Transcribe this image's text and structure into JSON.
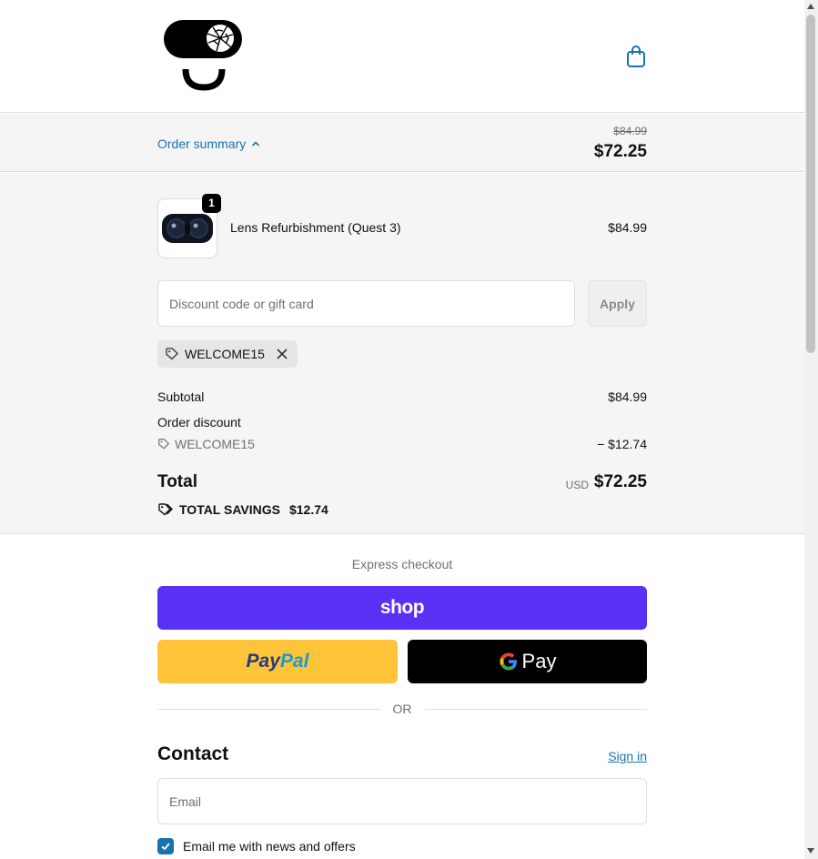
{
  "header": {
    "logo_icon": "broken-lens-face-logo",
    "cart_icon": "shopping-bag-icon"
  },
  "summary_toggle": {
    "label": "Order summary",
    "original_price": "$84.99",
    "price": "$72.25"
  },
  "product": {
    "quantity": "1",
    "name": "Lens Refurbishment (Quest 3)",
    "price": "$84.99"
  },
  "discount": {
    "placeholder": "Discount code or gift card",
    "apply_label": "Apply",
    "applied_code": "WELCOME15"
  },
  "totals": {
    "subtotal_label": "Subtotal",
    "subtotal_value": "$84.99",
    "order_discount_label": "Order discount",
    "discount_code": "WELCOME15",
    "discount_value": "− $12.74",
    "total_label": "Total",
    "currency": "USD",
    "total_value": "$72.25",
    "savings_label": "TOTAL SAVINGS",
    "savings_value": "$12.74"
  },
  "express": {
    "title": "Express checkout",
    "shop_label": "shop",
    "paypal_part1": "Pay",
    "paypal_part2": "Pal",
    "gpay_label": "Pay",
    "or_label": "OR"
  },
  "contact": {
    "title": "Contact",
    "signin_label": "Sign in",
    "email_placeholder": "Email",
    "newsletter_label": "Email me with news and offers",
    "newsletter_checked": true
  },
  "colors": {
    "link": "#1773b0",
    "shop_purple": "#5a31f4",
    "paypal_yellow": "#ffc439",
    "gpay_black": "#000000",
    "summary_bg": "#f5f5f5"
  }
}
